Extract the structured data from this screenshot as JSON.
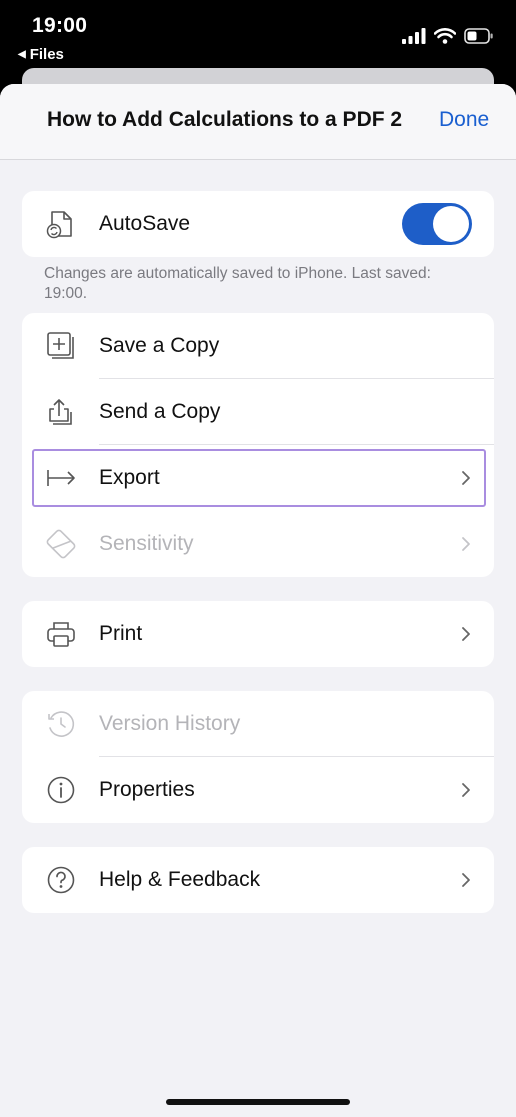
{
  "status_bar": {
    "time": "19:00",
    "back_label": "Files"
  },
  "header": {
    "title": "How to Add Calculations to a PDF 2",
    "done_label": "Done"
  },
  "autosave": {
    "label": "AutoSave",
    "enabled": true,
    "caption": "Changes are automatically saved to iPhone. Last saved: 19:00."
  },
  "file_actions": {
    "save_copy": "Save a Copy",
    "send_copy": "Send a Copy",
    "export": "Export",
    "sensitivity": "Sensitivity"
  },
  "print": {
    "label": "Print"
  },
  "info": {
    "version_history": "Version History",
    "properties": "Properties"
  },
  "help": {
    "label": "Help & Feedback"
  },
  "colors": {
    "accent": "#1a5fd0",
    "toggle_on": "#1e5ec8",
    "highlight": "#a98de0",
    "disabled_text": "#b4b4b8"
  }
}
